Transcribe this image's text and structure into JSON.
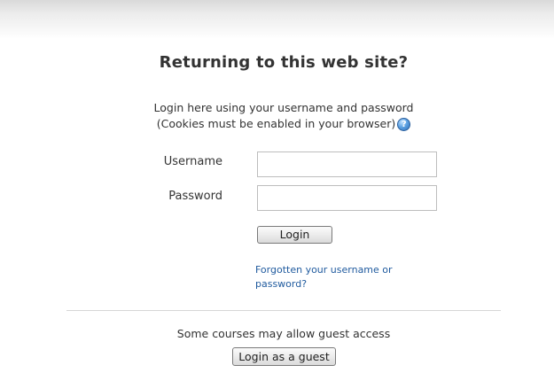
{
  "login": {
    "heading": "Returning to this web site?",
    "subtitle_line1": "Login here using your username and password",
    "subtitle_line2": "(Cookies must be enabled in your browser)",
    "help_icon": "help-icon",
    "help_glyph": "?",
    "username_label": "Username",
    "username_value": "",
    "password_label": "Password",
    "password_value": "",
    "login_button": "Login",
    "forgot_link": "Forgotten your username or password?"
  },
  "guest": {
    "text": "Some courses may allow guest access",
    "button": "Login as a guest"
  },
  "colors": {
    "link": "#1f5a9e",
    "text": "#333333",
    "divider": "#d6d6d6"
  }
}
